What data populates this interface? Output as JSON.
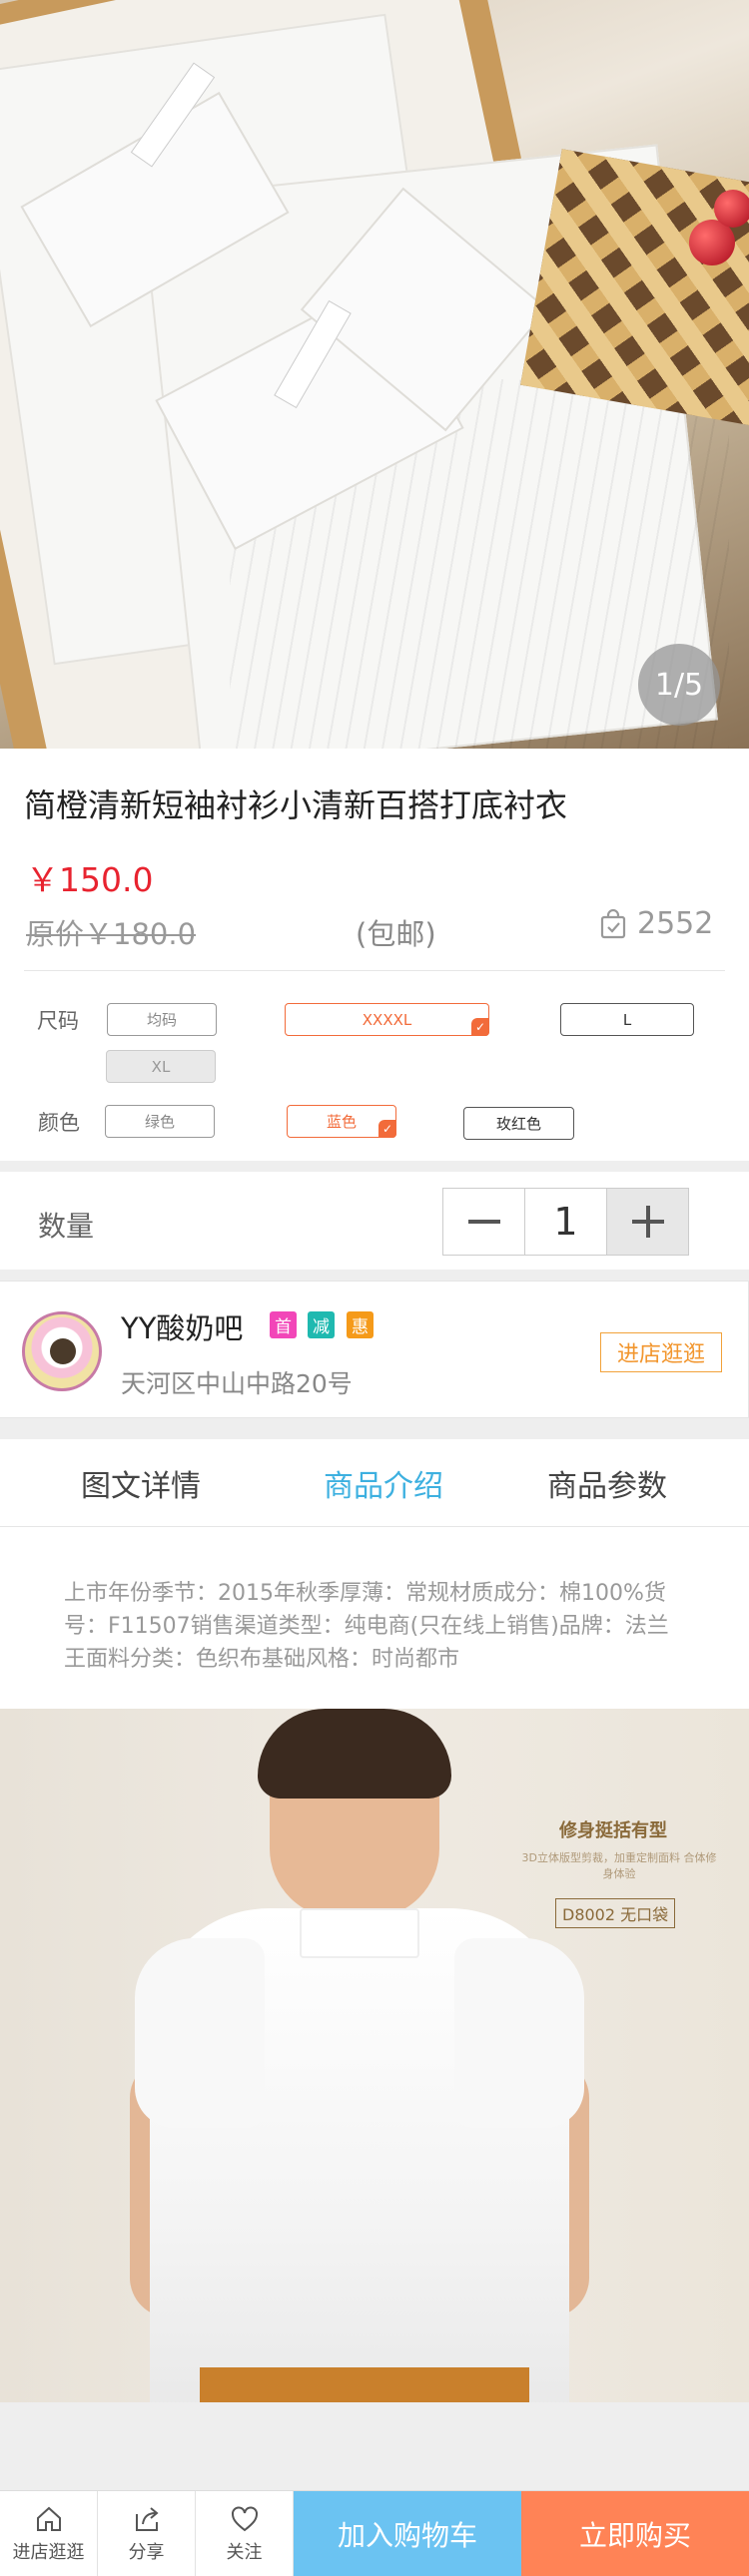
{
  "gallery": {
    "counter": "1/5"
  },
  "product": {
    "title": "简橙清新短袖衬衫小清新百搭打底衬衣",
    "price": "￥150.0",
    "original_price": "原价￥180.0",
    "shipping": "(包邮)",
    "sales_count": "2552"
  },
  "specs": {
    "size_label": "尺码",
    "sizes": [
      "均码",
      "XXXXL",
      "L",
      "XL"
    ],
    "selected_size": "XXXXL",
    "color_label": "颜色",
    "colors": [
      "绿色",
      "蓝色",
      "玫红色"
    ],
    "selected_color": "蓝色",
    "accent_color": "#f26b3a"
  },
  "quantity": {
    "label": "数量",
    "value": "1",
    "minus": "—",
    "plus": "+"
  },
  "shop": {
    "name": "YY酸奶吧",
    "badges": [
      "首",
      "减",
      "惠"
    ],
    "badge_colors": [
      "#f246b8",
      "#1fb9b0",
      "#f59a19"
    ],
    "address": "天河区中山中路20号",
    "enter_label": "进店逛逛"
  },
  "tabs": {
    "items": [
      "图文详情",
      "商品介绍",
      "商品参数"
    ],
    "active": "商品介绍"
  },
  "description": "上市年份季节：2015年秋季厚薄：常规材质成分：棉100%货号：F11507销售渠道类型：纯电商(只在线上销售)品牌：法兰王面料分类：色织布基础风格：时尚都市",
  "ad": {
    "title": "修身挺括有型",
    "subtitle": "3D立体版型剪裁，加重定制面料 合体修身体验",
    "code": "D8002 无口袋"
  },
  "bottom_bar": {
    "store": "进店逛逛",
    "share": "分享",
    "follow": "关注",
    "add_to_cart": "加入购物车",
    "buy_now": "立即购买",
    "cart_color": "#6bc3f2",
    "buy_color": "#ff8356"
  },
  "colors": {
    "price_red": "#e8232f",
    "tab_active": "#3db0e0"
  }
}
